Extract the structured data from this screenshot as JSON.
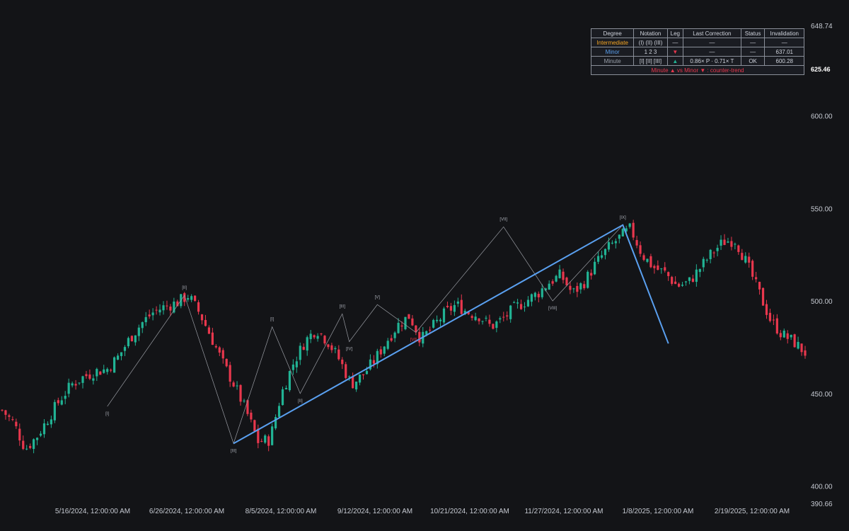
{
  "chart_data": {
    "type": "candlestick",
    "y_range": [
      390.66,
      648.74
    ],
    "y_ticks": [
      400,
      450,
      500,
      550,
      600
    ],
    "y_edge_labels": [
      "648.74",
      "390.66"
    ],
    "last_price_label": "625.46",
    "x_tick_labels": [
      "5/16/2024, 12:00:00 AM",
      "6/26/2024, 12:00:00 AM",
      "8/5/2024, 12:00:00 AM",
      "9/12/2024, 12:00:00 AM",
      "10/21/2024, 12:00:00 AM",
      "11/27/2024, 12:00:00 AM",
      "1/8/2025, 12:00:00 AM",
      "2/19/2025, 12:00:00 AM"
    ],
    "bar_count": 230,
    "path_points": [
      [
        0,
        441
      ],
      [
        10,
        434
      ],
      [
        20,
        420
      ],
      [
        30,
        427
      ],
      [
        40,
        437
      ],
      [
        50,
        447
      ],
      [
        60,
        455
      ],
      [
        70,
        459
      ],
      [
        80,
        462
      ],
      [
        90,
        463
      ],
      [
        100,
        470
      ],
      [
        110,
        480
      ],
      [
        120,
        488
      ],
      [
        130,
        494
      ],
      [
        140,
        497
      ],
      [
        150,
        499
      ],
      [
        160,
        503
      ],
      [
        170,
        493
      ],
      [
        180,
        480
      ],
      [
        190,
        466
      ],
      [
        200,
        454
      ],
      [
        210,
        440
      ],
      [
        220,
        424
      ],
      [
        230,
        425
      ],
      [
        240,
        450
      ],
      [
        250,
        466
      ],
      [
        260,
        478
      ],
      [
        270,
        485
      ],
      [
        280,
        478
      ],
      [
        290,
        468
      ],
      [
        300,
        455
      ],
      [
        310,
        460
      ],
      [
        320,
        468
      ],
      [
        330,
        478
      ],
      [
        340,
        487
      ],
      [
        350,
        492
      ],
      [
        360,
        479
      ],
      [
        370,
        486
      ],
      [
        380,
        493
      ],
      [
        390,
        498
      ],
      [
        400,
        494
      ],
      [
        410,
        492
      ],
      [
        420,
        486
      ],
      [
        430,
        490
      ],
      [
        440,
        496
      ],
      [
        450,
        500
      ],
      [
        460,
        504
      ],
      [
        470,
        510
      ],
      [
        480,
        514
      ],
      [
        490,
        504
      ],
      [
        500,
        510
      ],
      [
        510,
        520
      ],
      [
        520,
        528
      ],
      [
        530,
        534
      ],
      [
        540,
        539
      ],
      [
        550,
        525
      ],
      [
        560,
        518
      ],
      [
        570,
        515
      ],
      [
        580,
        508
      ],
      [
        590,
        510
      ],
      [
        600,
        518
      ],
      [
        610,
        526
      ],
      [
        620,
        532
      ],
      [
        630,
        533
      ],
      [
        640,
        520
      ],
      [
        650,
        505
      ],
      [
        660,
        490
      ],
      [
        670,
        482
      ],
      [
        680,
        478
      ],
      [
        690,
        472
      ]
    ],
    "zigzag": [
      {
        "x": 30,
        "y": 443
      },
      {
        "x": 52,
        "y": 503
      },
      {
        "x": 66,
        "y": 423
      },
      {
        "x": 77,
        "y": 486
      },
      {
        "x": 85,
        "y": 450
      },
      {
        "x": 97,
        "y": 493
      },
      {
        "x": 99,
        "y": 478
      },
      {
        "x": 107,
        "y": 498
      },
      {
        "x": 118,
        "y": 483
      },
      {
        "x": 143,
        "y": 540
      },
      {
        "x": 157,
        "y": 500
      },
      {
        "x": 177,
        "y": 541
      },
      {
        "x": 190,
        "y": 477
      }
    ],
    "major_line": [
      {
        "x": 66,
        "y": 423
      },
      {
        "x": 177,
        "y": 541
      },
      {
        "x": 190,
        "y": 477
      }
    ],
    "wave_labels": [
      {
        "text": "[I]",
        "x": 30,
        "y": 443,
        "pos": "below",
        "red": false
      },
      {
        "text": "[II]",
        "x": 52,
        "y": 503,
        "pos": "above",
        "red": false
      },
      {
        "text": "[III]",
        "x": 66,
        "y": 423,
        "pos": "below",
        "red": false
      },
      {
        "text": "[I]",
        "x": 77,
        "y": 486,
        "pos": "above",
        "red": false
      },
      {
        "text": "[II]",
        "x": 85,
        "y": 450,
        "pos": "below",
        "red": false
      },
      {
        "text": "[III]",
        "x": 97,
        "y": 493,
        "pos": "above",
        "red": false
      },
      {
        "text": "[IV]",
        "x": 99,
        "y": 478,
        "pos": "below",
        "red": false
      },
      {
        "text": "[V]",
        "x": 107,
        "y": 498,
        "pos": "above",
        "red": false
      },
      {
        "text": "[VI] ⚠",
        "x": 118,
        "y": 483,
        "pos": "below",
        "red": true
      },
      {
        "text": "[VII]",
        "x": 143,
        "y": 540,
        "pos": "above",
        "red": false
      },
      {
        "text": "[VIII]",
        "x": 157,
        "y": 500,
        "pos": "below",
        "red": false
      },
      {
        "text": "[IX]",
        "x": 177,
        "y": 541,
        "pos": "above",
        "red": false
      }
    ],
    "colors": {
      "up": "#21b394",
      "down": "#e8374d",
      "major": "#5aa0f0",
      "zigzag": "#9a9da4",
      "axis_text": "#c5c9d1",
      "bg": "#131417"
    }
  },
  "panel": {
    "headers": [
      "Degree",
      "Notation",
      "Leg",
      "Last Correction",
      "Status",
      "Invalidation"
    ],
    "rows": [
      {
        "degree": "Intermediate",
        "notation": "(I) (II) (III)",
        "leg": "—",
        "correction": "—",
        "status": "—",
        "invalidation": "—"
      },
      {
        "degree": "Minor",
        "notation": "1 2 3",
        "leg": "▼",
        "correction": "—",
        "status": "—",
        "invalidation": "637.01"
      },
      {
        "degree": "Minute",
        "notation": "[I] [II] [III]",
        "leg": "▲",
        "correction": "0.86× P · 0.71× T",
        "status": "OK",
        "invalidation": "600.28"
      }
    ],
    "note": "Minute ▲  vs  Minor ▼  :  counter-trend"
  }
}
